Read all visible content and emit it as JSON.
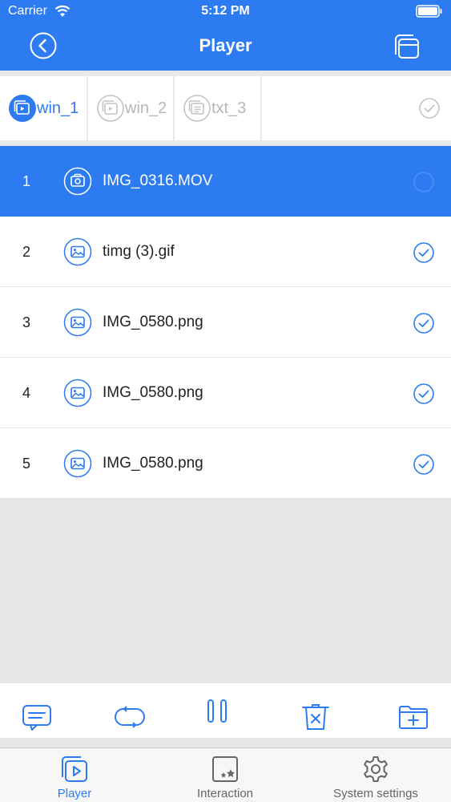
{
  "status_bar": {
    "carrier": "Carrier",
    "time": "5:12 PM"
  },
  "header": {
    "title": "Player"
  },
  "windows": [
    {
      "label": "win_1",
      "active": true
    },
    {
      "label": "win_2",
      "active": false
    },
    {
      "label": "txt_3",
      "active": false
    }
  ],
  "files": [
    {
      "index": "1",
      "name": "IMG_0316.MOV",
      "type": "video",
      "selected": true
    },
    {
      "index": "2",
      "name": "timg (3).gif",
      "type": "image",
      "selected": false
    },
    {
      "index": "3",
      "name": "IMG_0580.png",
      "type": "image",
      "selected": false
    },
    {
      "index": "4",
      "name": "IMG_0580.png",
      "type": "image",
      "selected": false
    },
    {
      "index": "5",
      "name": "IMG_0580.png",
      "type": "image",
      "selected": false
    }
  ],
  "toolbar_icons": [
    "message-icon",
    "loop-icon",
    "pause-icon",
    "delete-icon",
    "add-folder-icon"
  ],
  "tabbar": [
    {
      "label": "Player",
      "icon": "player-icon",
      "active": true
    },
    {
      "label": "Interaction",
      "icon": "interaction-icon",
      "active": false
    },
    {
      "label": "System settings",
      "icon": "gear-icon",
      "active": false
    }
  ],
  "colors": {
    "accent": "#2d7bf0",
    "inactive": "#b8b8b8"
  }
}
